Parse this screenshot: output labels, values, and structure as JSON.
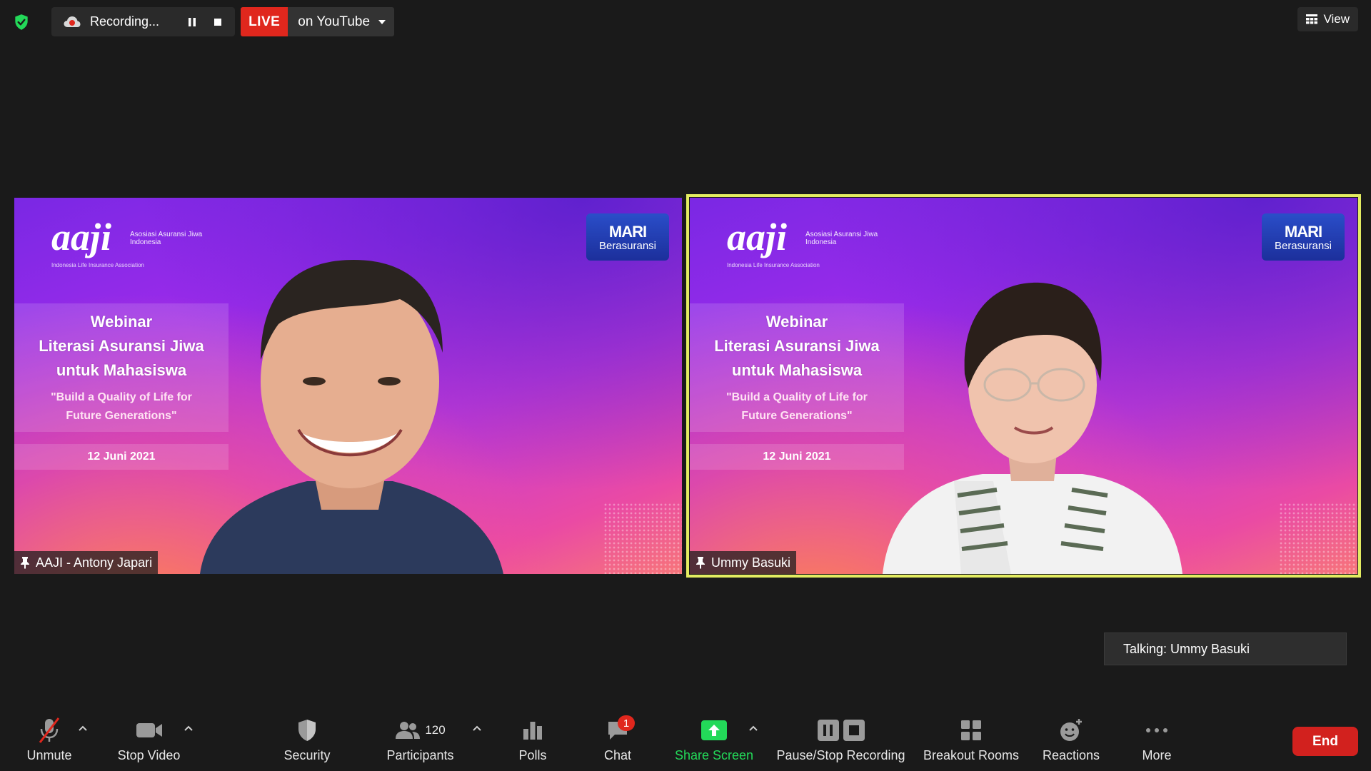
{
  "recording": {
    "label": "Recording..."
  },
  "live": {
    "tag": "LIVE",
    "destination": "on YouTube"
  },
  "view": {
    "label": "View"
  },
  "slide": {
    "logo_main": "aaji",
    "logo_small": "Asosiasi Asuransi Jiwa Indonesia",
    "logo_sub": "Indonesia Life Insurance Association",
    "mari_top": "MARI",
    "mari_bottom": "Berasuransi",
    "title_1": "Webinar",
    "title_2": "Literasi Asuransi Jiwa",
    "title_3": "untuk Mahasiswa",
    "quote_1": "\"Build a Quality of Life for",
    "quote_2": "Future Generations\"",
    "date": "12 Juni 2021"
  },
  "tiles": [
    {
      "name": "AAJI - Antony Japari"
    },
    {
      "name": "Ummy Basuki"
    }
  ],
  "talking": "Talking: Ummy Basuki",
  "toolbar": {
    "unmute": "Unmute",
    "stop_video": "Stop Video",
    "security": "Security",
    "participants": "Participants",
    "participants_count": "120",
    "polls": "Polls",
    "chat": "Chat",
    "chat_badge": "1",
    "share_screen": "Share Screen",
    "pause_stop_recording": "Pause/Stop Recording",
    "breakout_rooms": "Breakout Rooms",
    "reactions": "Reactions",
    "more": "More",
    "end": "End"
  },
  "colors": {
    "live_red": "#e0271d",
    "share_green": "#23d959",
    "active_speaker": "#e3ec61",
    "end_red": "#d2211e",
    "security_green": "#23d959"
  }
}
